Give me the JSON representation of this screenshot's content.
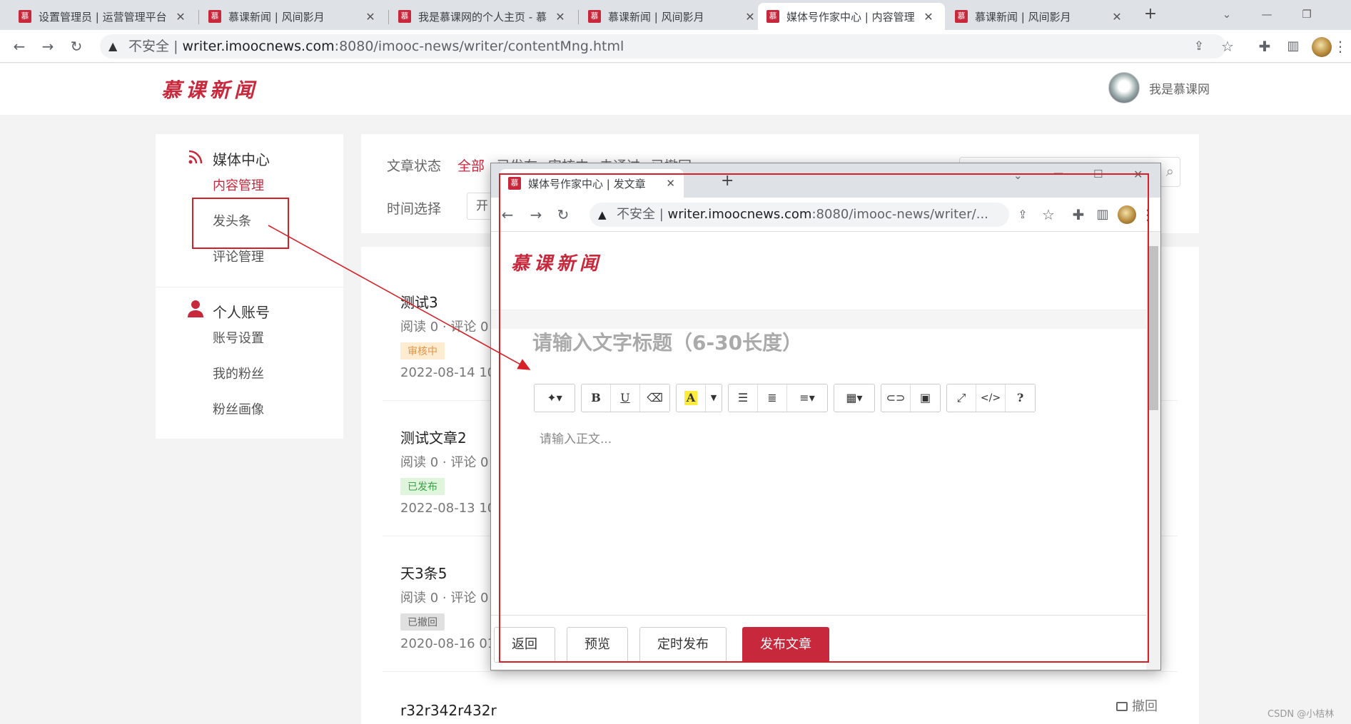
{
  "browser": {
    "tabs": [
      {
        "title": "设置管理员 | 运营管理平台",
        "icon": "慕"
      },
      {
        "title": "慕课新闻 | 风间影月",
        "icon": "慕"
      },
      {
        "title": "我是慕课网的个人主页 - 慕",
        "icon": "慕"
      },
      {
        "title": "慕课新闻 | 风间影月",
        "icon": "慕"
      },
      {
        "title": "媒体号作家中心 | 内容管理",
        "icon": "慕"
      },
      {
        "title": "慕课新闻 | 风间影月",
        "icon": "慕"
      }
    ],
    "active_tab": 4,
    "insecure_label": "不安全",
    "url_host": "writer.imoocnews.com",
    "url_rest": ":8080/imooc-news/writer/contentMng.html"
  },
  "header": {
    "logo": "慕课新闻",
    "user_name": "我是慕课网"
  },
  "sidebar": {
    "media_center": "媒体中心",
    "media_items": [
      "内容管理",
      "发头条",
      "评论管理"
    ],
    "account": "个人账号",
    "account_items": [
      "账号设置",
      "我的粉丝",
      "粉丝画像"
    ]
  },
  "filters": {
    "status_label": "文章状态",
    "status_options": [
      "全部",
      "已发布",
      "审核中",
      "未通过",
      "已撤回"
    ],
    "time_label": "时间选择",
    "time_value": "开"
  },
  "articles": [
    {
      "title": "测试3",
      "meta": "阅读 0 · 评论 0",
      "status": "审核中",
      "date": "2022-08-14 10:"
    },
    {
      "title": "测试文章2",
      "meta": "阅读 0 · 评论 0",
      "status": "已发布",
      "date": "2022-08-13 10:"
    },
    {
      "title": "天3条5",
      "meta": "阅读 0 · 评论 0",
      "status": "已撤回",
      "date": "2020-08-16 01:"
    },
    {
      "title": "r32r342r432r"
    }
  ],
  "revoke_label": "撤回",
  "popup": {
    "tab_title": "媒体号作家中心 | 发文章",
    "tab_icon": "慕",
    "insecure_label": "不安全",
    "url_host": "writer.imoocnews.com",
    "url_rest": ":8080/imooc-news/writer/...",
    "logo": "慕课新闻",
    "title_placeholder": "请输入文字标题（6-30长度）",
    "body_placeholder": "请输入正文...",
    "toolbar_buttons": [
      "B",
      "U",
      "A",
      "?"
    ],
    "buttons": {
      "back": "返回",
      "preview": "预览",
      "schedule": "定时发布",
      "publish": "发布文章"
    }
  },
  "colors": {
    "brand": "#c8283c",
    "annotation": "#d61f26"
  },
  "watermark": "CSDN @小桔林"
}
